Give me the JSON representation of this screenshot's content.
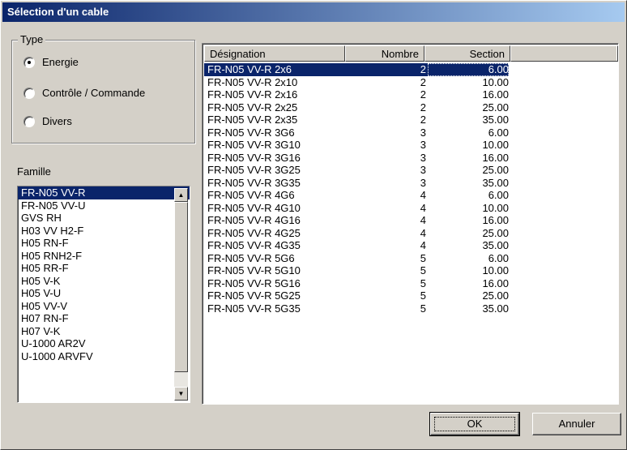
{
  "window": {
    "title": "Sélection d'un cable"
  },
  "type_group": {
    "label": "Type",
    "options": [
      {
        "label": "Energie",
        "checked": true
      },
      {
        "label": "Contrôle / Commande",
        "checked": false
      },
      {
        "label": "Divers",
        "checked": false
      }
    ]
  },
  "famille": {
    "label": "Famille",
    "items": [
      "FR-N05 VV-R",
      "FR-N05 VV-U",
      "GVS RH",
      "H03 VV H2-F",
      "H05 RN-F",
      "H05 RNH2-F",
      "H05 RR-F",
      "H05 V-K",
      "H05 V-U",
      "H05 VV-V",
      "H07 RN-F",
      "H07 V-K",
      "U-1000 AR2V",
      "U-1000 ARVFV"
    ],
    "selected_index": 0
  },
  "cable_list": {
    "columns": [
      "Désignation",
      "Nombre",
      "Section"
    ],
    "selected_index": 0,
    "rows": [
      [
        "FR-N05 VV-R 2x6",
        "2",
        "6.00"
      ],
      [
        "FR-N05 VV-R 2x10",
        "2",
        "10.00"
      ],
      [
        "FR-N05 VV-R 2x16",
        "2",
        "16.00"
      ],
      [
        "FR-N05 VV-R 2x25",
        "2",
        "25.00"
      ],
      [
        "FR-N05 VV-R 2x35",
        "2",
        "35.00"
      ],
      [
        "FR-N05 VV-R 3G6",
        "3",
        "6.00"
      ],
      [
        "FR-N05 VV-R 3G10",
        "3",
        "10.00"
      ],
      [
        "FR-N05 VV-R 3G16",
        "3",
        "16.00"
      ],
      [
        "FR-N05 VV-R 3G25",
        "3",
        "25.00"
      ],
      [
        "FR-N05 VV-R 3G35",
        "3",
        "35.00"
      ],
      [
        "FR-N05 VV-R 4G6",
        "4",
        "6.00"
      ],
      [
        "FR-N05 VV-R 4G10",
        "4",
        "10.00"
      ],
      [
        "FR-N05 VV-R 4G16",
        "4",
        "16.00"
      ],
      [
        "FR-N05 VV-R 4G25",
        "4",
        "25.00"
      ],
      [
        "FR-N05 VV-R 4G35",
        "4",
        "35.00"
      ],
      [
        "FR-N05 VV-R 5G6",
        "5",
        "6.00"
      ],
      [
        "FR-N05 VV-R 5G10",
        "5",
        "10.00"
      ],
      [
        "FR-N05 VV-R 5G16",
        "5",
        "16.00"
      ],
      [
        "FR-N05 VV-R 5G25",
        "5",
        "25.00"
      ],
      [
        "FR-N05 VV-R 5G35",
        "5",
        "35.00"
      ]
    ]
  },
  "buttons": {
    "ok": "OK",
    "cancel": "Annuler"
  },
  "icons": {
    "scroll_up": "scroll-up-arrow-icon",
    "scroll_down": "scroll-down-arrow-icon"
  },
  "colors": {
    "selection": "#0a246a",
    "face": "#d4d0c8"
  }
}
